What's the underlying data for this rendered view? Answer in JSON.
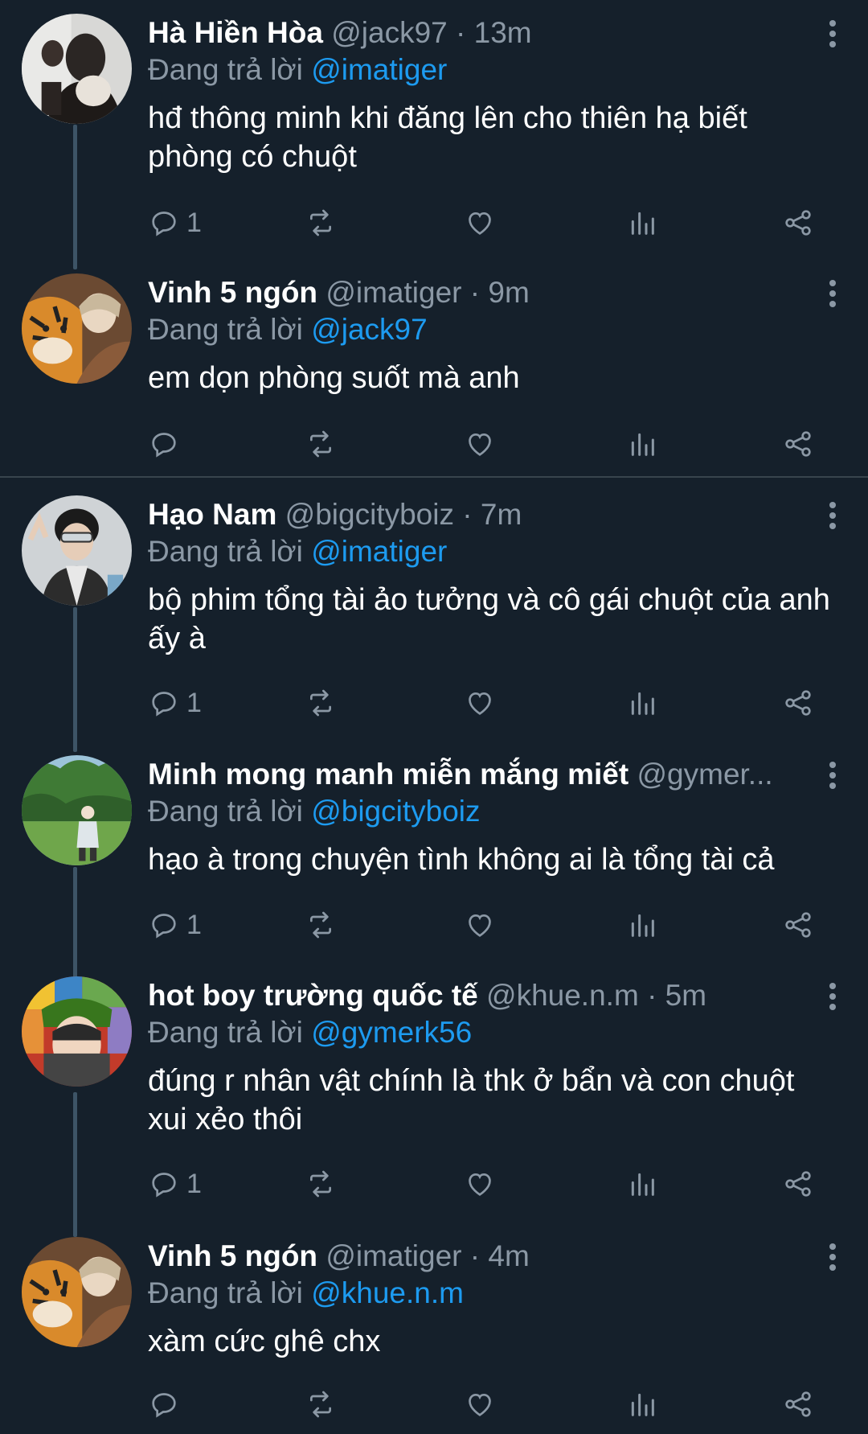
{
  "tweets": [
    {
      "name": "Hà Hiền Hòa",
      "handle": "@jack97",
      "separator": "·",
      "time": "13m",
      "replying_prefix": "Đang trả lời",
      "replying_to": "@imatiger",
      "text": "hđ thông minh khi đăng lên cho thiên hạ biết phòng có chuột",
      "reply_count": "1"
    },
    {
      "name": "Vinh 5 ngón",
      "handle": "@imatiger",
      "separator": "·",
      "time": "9m",
      "replying_prefix": "Đang trả lời",
      "replying_to": "@jack97",
      "text": "em dọn phòng suốt mà anh",
      "reply_count": ""
    },
    {
      "name": "Hạo Nam",
      "handle": "@bigcityboiz",
      "separator": "·",
      "time": "7m",
      "replying_prefix": "Đang trả lời",
      "replying_to": "@imatiger",
      "text": "bộ phim tổng tài ảo tưởng và cô gái chuột của anh ấy à",
      "reply_count": "1"
    },
    {
      "name": "Minh mong manh miễn mắng miết",
      "handle": "@gymer...",
      "separator": "",
      "time": "",
      "replying_prefix": "Đang trả lời",
      "replying_to": "@bigcityboiz",
      "text": "hạo à trong chuyện tình không ai là tổng tài cả",
      "reply_count": "1"
    },
    {
      "name": "hot boy trường quốc tế",
      "handle": "@khue.n.m",
      "separator": "·",
      "time": "5m",
      "replying_prefix": "Đang trả lời",
      "replying_to": "@gymerk56",
      "text": "đúng r nhân vật chính là thk ở bẩn và con chuột xui xẻo thôi",
      "reply_count": "1"
    },
    {
      "name": "Vinh 5 ngón",
      "handle": "@imatiger",
      "separator": "·",
      "time": "4m",
      "replying_prefix": "Đang trả lời",
      "replying_to": "@khue.n.m",
      "text": "xàm cức ghê chx",
      "reply_count": ""
    }
  ],
  "icons": {
    "reply": "reply-icon",
    "retweet": "retweet-icon",
    "like": "heart-icon",
    "stats": "stats-icon",
    "share": "share-icon",
    "more": "more-options-icon"
  },
  "colors": {
    "background": "#15202b",
    "text": "#ffffff",
    "muted": "#8b98a5",
    "link": "#1d9bf0",
    "divider": "#38444d"
  }
}
